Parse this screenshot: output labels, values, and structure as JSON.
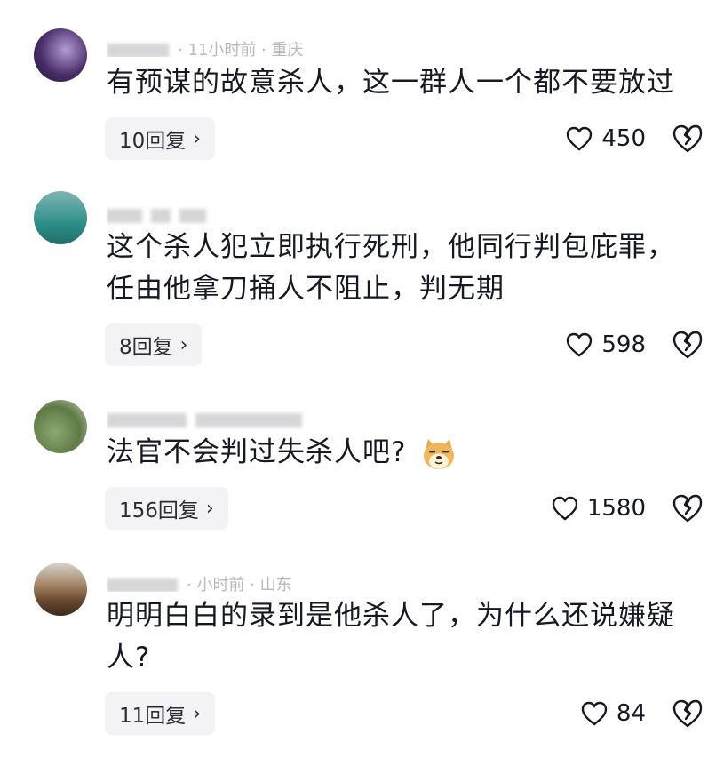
{
  "comments": [
    {
      "meta": "· 11小时前 · 重庆",
      "text": "有预谋的故意杀人，这一群人一个都不要放过",
      "reply_label": "10回复",
      "likes": "450"
    },
    {
      "meta": "",
      "text": "这个杀人犯立即执行死刑，他同行判包庇罪，任由他拿刀捅人不阻止，判无期",
      "reply_label": "8回复",
      "likes": "598"
    },
    {
      "meta": "",
      "text": "法官不会判过失杀人吧?",
      "reply_label": "156回复",
      "likes": "1580"
    },
    {
      "meta": "· 小时前 · 山东",
      "text": "明明白白的录到是他杀人了，为什么还说嫌疑人?",
      "reply_label": "11回复",
      "likes": "84"
    }
  ],
  "icons": {
    "like": "heart-outline-icon",
    "dislike": "broken-heart-icon",
    "reply_chevron": "chevron-right-icon",
    "emoji": "doge-emoji-icon"
  },
  "colors": {
    "text": "#161823",
    "meta": "#b8b8bc",
    "reply_bg": "#f3f3f5"
  }
}
